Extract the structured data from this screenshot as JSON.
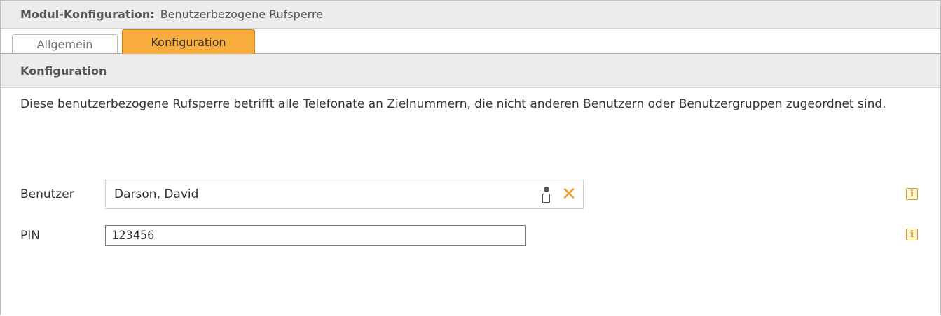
{
  "header": {
    "label": "Modul-Konfiguration:",
    "module_name": "Benutzerbezogene Rufsperre"
  },
  "tabs": [
    {
      "label": "Allgemein",
      "active": false
    },
    {
      "label": "Konfiguration",
      "active": true
    }
  ],
  "section": {
    "title": "Konfiguration",
    "description": "Diese benutzerbezogene Rufsperre betrifft alle Telefonate an Zielnummern, die nicht anderen Benutzern oder Benutzergruppen zugeordnet sind."
  },
  "form": {
    "user": {
      "label": "Benutzer",
      "value": "Darson, David",
      "clear_symbol": "✕"
    },
    "pin": {
      "label": "PIN",
      "value": "123456"
    },
    "info_symbol": "i"
  },
  "colors": {
    "active_tab": "#f7ac3b",
    "accent": "#f29b22",
    "header_bg": "#ececec"
  },
  "icons": {
    "user_picker": "user-icon",
    "clear": "close-icon",
    "info": "info-icon"
  }
}
